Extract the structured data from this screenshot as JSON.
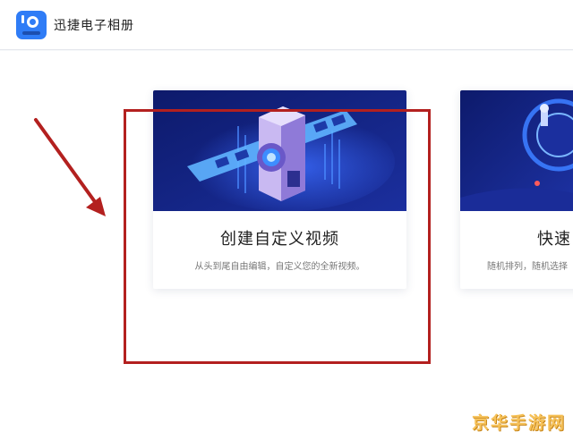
{
  "app": {
    "title": "迅捷电子相册"
  },
  "cards": [
    {
      "title": "创建自定义视频",
      "description": "从头到尾自由编辑，自定义您的全新视频。",
      "icon": "film-projector-illustration"
    },
    {
      "title": "快速",
      "description": "随机排列，随机选择",
      "icon": "robot-illustration"
    }
  ],
  "annotation": {
    "highlight_color": "#b3201f",
    "arrow_color": "#b3201f"
  },
  "watermark": {
    "text": "京华手游网"
  }
}
